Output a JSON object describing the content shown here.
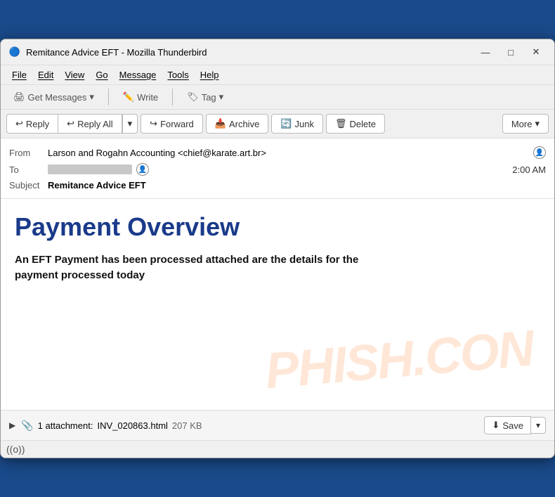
{
  "window": {
    "title": "Remitance Advice EFT - Mozilla Thunderbird",
    "icon": "🔵"
  },
  "window_controls": {
    "minimize": "—",
    "maximize": "□",
    "close": "✕"
  },
  "menubar": {
    "items": [
      "File",
      "Edit",
      "View",
      "Go",
      "Message",
      "Tools",
      "Help"
    ]
  },
  "toolbar": {
    "get_messages": "Get Messages",
    "write": "Write",
    "tag": "Tag"
  },
  "action_bar": {
    "reply": "Reply",
    "reply_all": "Reply All",
    "forward": "Forward",
    "archive": "Archive",
    "junk": "Junk",
    "delete": "Delete",
    "more": "More"
  },
  "email_header": {
    "from_label": "From",
    "from_value": "Larson and Rogahn Accounting <chief@karate.art.br>",
    "to_label": "To",
    "time": "2:00 AM",
    "subject_label": "Subject",
    "subject_value": "Remitance Advice EFT"
  },
  "email_body": {
    "heading": "Payment Overview",
    "body_text": "An EFT Payment has been processed attached are the details for the payment processed today",
    "watermark": "PHISH.CON"
  },
  "attachment": {
    "count": "1 attachment:",
    "filename": "INV_020863.html",
    "size": "207 KB",
    "save_label": "Save"
  },
  "statusbar": {
    "icon": "((o))"
  }
}
